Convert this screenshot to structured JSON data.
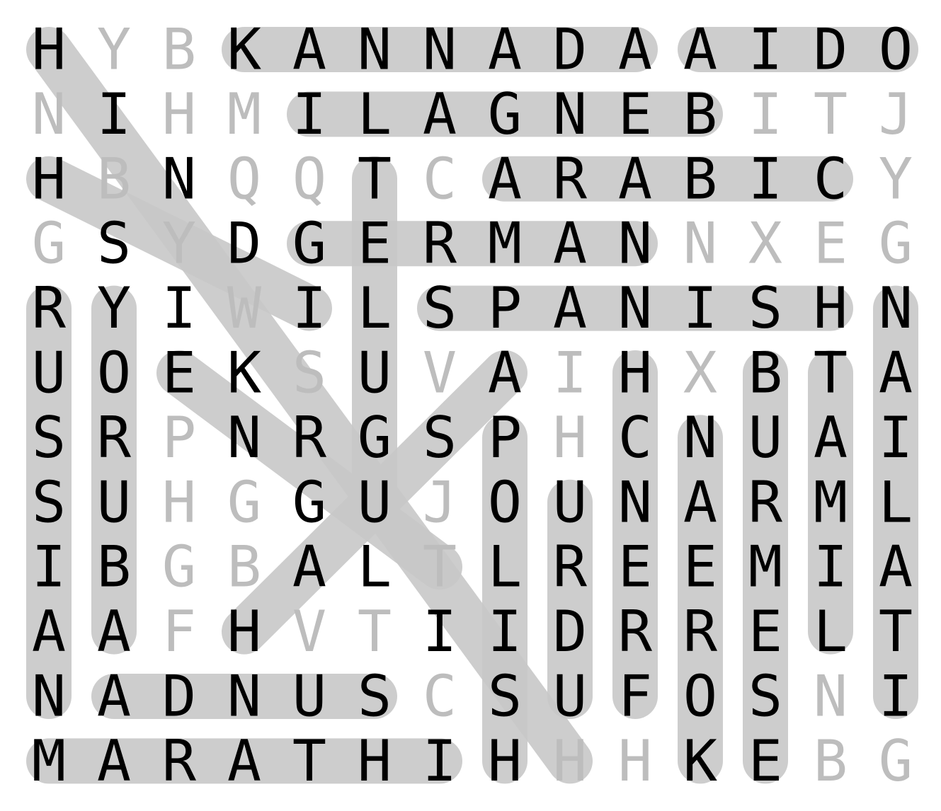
{
  "grid": [
    "HYBKANNADAAIDO",
    "NIHMILAGNEBITJ",
    "HBNQQTCARABICY",
    "GSYDGERMANNXEG",
    "RYIWILSPANISHN",
    "UOEKSUVAIHXBTA",
    "SRPNRGSPHCNUAI",
    "SUHGGUJOUNARML",
    "IBGBALTLREEMIA",
    "AAFHVTIIDRRELT",
    "NADNUSCSUFOSNI",
    "MARATHIHHHKEBG"
  ],
  "found_words": [
    {
      "word": "KANNADA",
      "start": [
        0,
        3
      ],
      "end": [
        0,
        9
      ]
    },
    {
      "word": "ODIA",
      "start": [
        0,
        13
      ],
      "end": [
        0,
        10
      ]
    },
    {
      "word": "BENGALI",
      "start": [
        1,
        10
      ],
      "end": [
        1,
        4
      ]
    },
    {
      "word": "ARABIC",
      "start": [
        2,
        7
      ],
      "end": [
        2,
        12
      ]
    },
    {
      "word": "GERMAN",
      "start": [
        3,
        4
      ],
      "end": [
        3,
        9
      ]
    },
    {
      "word": "SPANISH",
      "start": [
        4,
        6
      ],
      "end": [
        4,
        12
      ]
    },
    {
      "word": "TELUGU",
      "start": [
        2,
        5
      ],
      "end": [
        7,
        5
      ]
    },
    {
      "word": "RUSSIAN",
      "start": [
        4,
        0
      ],
      "end": [
        10,
        0
      ]
    },
    {
      "word": "YORUBA",
      "start": [
        4,
        1
      ],
      "end": [
        9,
        1
      ]
    },
    {
      "word": "NAIMALATI",
      "start": [
        4,
        13
      ],
      "end": [
        10,
        13
      ]
    },
    {
      "word": "HCNERF",
      "start": [
        5,
        9
      ],
      "end": [
        10,
        9
      ]
    },
    {
      "word": "BURMESE",
      "start": [
        5,
        11
      ],
      "end": [
        11,
        11
      ]
    },
    {
      "word": "TAMIL",
      "start": [
        5,
        12
      ],
      "end": [
        9,
        12
      ]
    },
    {
      "word": "NAEROK",
      "start": [
        6,
        10
      ],
      "end": [
        11,
        10
      ]
    },
    {
      "word": "URDU",
      "start": [
        7,
        8
      ],
      "end": [
        10,
        8
      ]
    },
    {
      "word": "POLISH",
      "start": [
        6,
        7
      ],
      "end": [
        11,
        7
      ]
    },
    {
      "word": "SUNDA",
      "start": [
        10,
        5
      ],
      "end": [
        10,
        1
      ]
    },
    {
      "word": "MARATHI",
      "start": [
        11,
        0
      ],
      "end": [
        11,
        6
      ]
    },
    {
      "word": "HINDI",
      "start": [
        2,
        0
      ],
      "end": [
        4,
        4
      ]
    },
    {
      "word": "HINDUSTANI",
      "start": [
        0,
        0
      ],
      "end": [
        11,
        8
      ]
    },
    {
      "word": "EKGUT",
      "start": [
        5,
        2
      ],
      "end": [
        8,
        6
      ]
    },
    {
      "word": "AGUH",
      "start": [
        5,
        7
      ],
      "end": [
        9,
        3
      ]
    }
  ],
  "colors": {
    "highlight": "#c8c8c8",
    "found_letter": "#000000",
    "unfound_letter": "#bdbdbd"
  }
}
